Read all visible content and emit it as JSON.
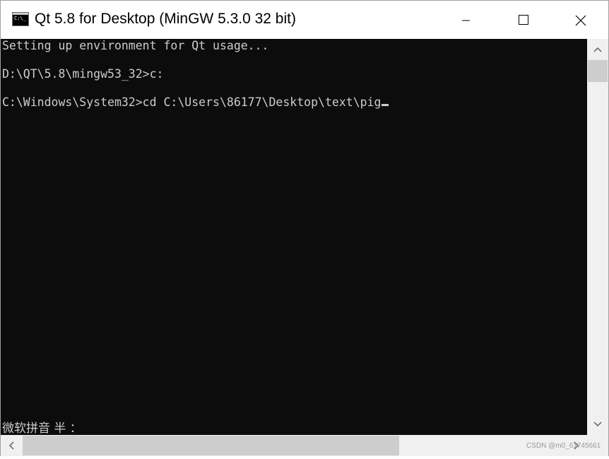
{
  "window": {
    "title": "Qt 5.8 for Desktop (MinGW 5.3.0 32 bit)",
    "icon": "console-icon"
  },
  "caption_buttons": {
    "minimize": "minimize-icon",
    "maximize": "maximize-icon",
    "close": "close-icon"
  },
  "console": {
    "lines": [
      "Setting up environment for Qt usage...",
      "D:\\QT\\5.8\\mingw53_32>c:",
      "C:\\Windows\\System32>cd C:\\Users\\86177\\Desktop\\text\\pig"
    ],
    "ime_status": "微软拼音 半 ：",
    "background": "#0c0c0c",
    "foreground": "#cccccc"
  },
  "watermark": "CSDN @m0_61745661"
}
